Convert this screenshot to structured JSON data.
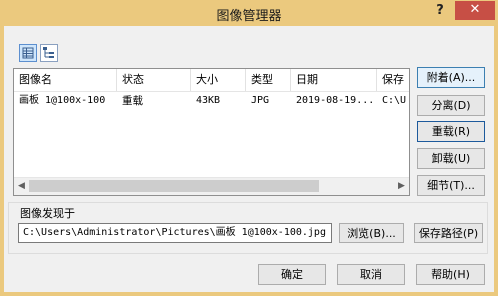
{
  "window": {
    "title": "图像管理器",
    "help_glyph": "?",
    "close_glyph": "✕"
  },
  "view_buttons": [
    {
      "name": "details-view",
      "icon": "details-view-icon",
      "active": true
    },
    {
      "name": "tree-view",
      "icon": "tree-view-icon",
      "active": false
    }
  ],
  "list": {
    "columns": [
      "图像名",
      "状态",
      "大小",
      "类型",
      "日期",
      "保存"
    ],
    "rows": [
      [
        "画板 1@100x-100",
        "重载",
        "43KB",
        "JPG",
        "2019-08-19...",
        "C:\\U"
      ]
    ]
  },
  "side_buttons": {
    "attach": "附着(A)...",
    "detach": "分离(D)",
    "reload": "重载(R)",
    "unload": "卸载(U)",
    "details": "细节(T)..."
  },
  "found_at": {
    "label": "图像发现于",
    "path": "C:\\Users\\Administrator\\Pictures\\画板 1@100x-100.jpg",
    "browse": "浏览(B)...",
    "save_path": "保存路径(P)"
  },
  "footer": {
    "ok": "确定",
    "cancel": "取消",
    "help": "帮助(H)"
  },
  "colors": {
    "titlebar": "#ebc97e",
    "close": "#c74f45",
    "default_button_border": "#3c7fb1"
  }
}
